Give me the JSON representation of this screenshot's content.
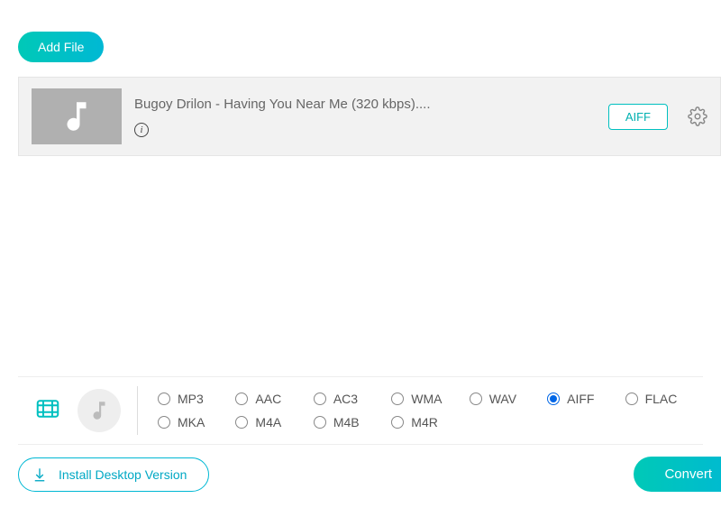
{
  "toolbar": {
    "add_file_label": "Add File"
  },
  "file": {
    "title": "Bugoy Drilon - Having You Near Me (320 kbps)....",
    "format_badge": "AIFF"
  },
  "formats": {
    "row1": [
      "MP3",
      "AAC",
      "AC3",
      "WMA",
      "WAV",
      "AIFF",
      "FLAC"
    ],
    "row2": [
      "MKA",
      "M4A",
      "M4B",
      "M4R"
    ],
    "selected": "AIFF"
  },
  "bottom": {
    "install_label": "Install Desktop Version",
    "convert_label": "Convert"
  }
}
